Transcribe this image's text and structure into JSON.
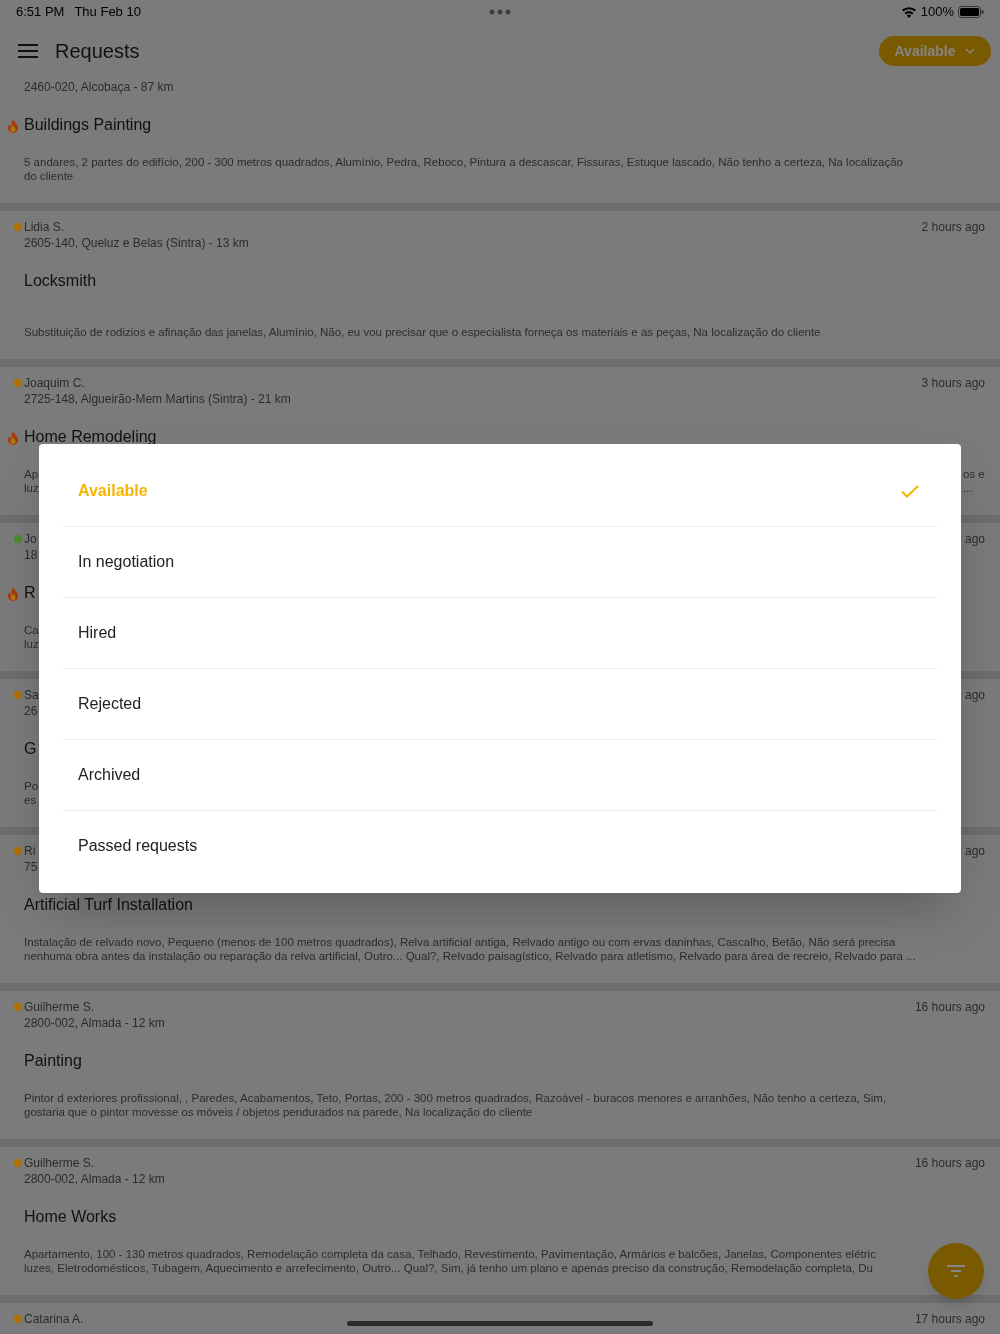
{
  "status_bar": {
    "time": "6:51 PM",
    "date": "Thu Feb 10",
    "battery": "100%"
  },
  "header": {
    "title": "Requests",
    "status_button": "Available"
  },
  "requests": [
    {
      "address": "2460-020, Alcobaça - 87 km",
      "title": "Buildings Painting",
      "urgent": true,
      "description": [
        "5 andares, 2 partes do edifício, 200 - 300 metros quadrados, Alumínio, Pedra, Reboco, Pintura a descascar, Fissuras, Estuque lascado, Não tenho a certeza, Na localização",
        "do cliente"
      ]
    },
    {
      "name": "Lidia S.",
      "color": "#b06f00",
      "time": "2 hours ago",
      "address": "2605-140, Queluz e Belas (Sintra) - 13 km",
      "title": "Locksmith",
      "urgent": false,
      "description": [
        "Substituição de rodizios e afinação das janelas, Alumínio, Não, eu vou precisar que o especialista forneça os materiais e as peças, Na localização do cliente"
      ]
    },
    {
      "name": "Joaquim C.",
      "color": "#b06f00",
      "time": "3 hours ago",
      "address": "2725-148, Algueirão-Mem Martins (Sintra) - 21 km",
      "title": "Home Remodeling",
      "urgent": true,
      "description": [
        "Ap",
        "luz"
      ],
      "description_end": [
        "os e",
        "..."
      ]
    },
    {
      "name": "Jo",
      "color": "#4d8a2b",
      "time": "ago",
      "address": "18",
      "title": "R",
      "urgent": true,
      "description": [
        "Ca",
        "luz"
      ]
    },
    {
      "name": "Sa",
      "color": "#b06f00",
      "time": "ago",
      "address": "26",
      "title": "G",
      "urgent": false,
      "description": [
        "Po",
        "es"
      ]
    },
    {
      "name": "Ri",
      "color": "#b06f00",
      "time": "ago",
      "address": "75",
      "title": "Artificial Turf Installation",
      "urgent": false,
      "description": [
        "Instalação de relvado novo, Pequeno (menos de 100 metros quadrados), Relva artificial antiga, Relvado antigo ou com ervas daninhas, Cascalho, Betão, Não será precisa",
        "nenhuma obra antes da instalação ou reparação da relva artificial, Outro... Qual?, Relvado paisagístico, Relvado para atletismo, Relvado para área de recreio, Relvado para ..."
      ]
    },
    {
      "name": "Guilherme S.",
      "color": "#b06f00",
      "time": "16 hours ago",
      "address": "2800-002, Almada - 12 km",
      "title": "Painting",
      "urgent": false,
      "description": [
        "Pintor d exteriores profissional, , Paredes, Acabamentos, Teto, Portas, 200 - 300 metros quadrados, Razoável - buracos menores e arranhões, Não tenho a certeza, Sim,",
        "gostaria que o pintor movesse os móveis / objetos pendurados na parede, Na localização do cliente"
      ]
    },
    {
      "name": "Guilherme S.",
      "color": "#b06f00",
      "time": "16 hours ago",
      "address": "2800-002, Almada - 12 km",
      "title": "Home Works",
      "urgent": false,
      "description": [
        "Apartamento, 100 - 130 metros quadrados, Remodelação completa da casa, Telhado, Revestimento, Pavimentação, Armários e balcões, Janelas, Componentes elétric",
        "luzes, Eletrodomésticos, Tubagem, Aquecimento e arrefecimento, Outro... Qual?, Sim, já tenho um plano e apenas preciso da construção, Remodelação completa, Du"
      ]
    },
    {
      "name": "Catarina A.",
      "color": "#b06f00",
      "time": "17 hours ago",
      "urgent": false
    }
  ],
  "status_menu": [
    {
      "label": "Available",
      "selected": true
    },
    {
      "label": "In negotiation",
      "selected": false
    },
    {
      "label": "Hired",
      "selected": false
    },
    {
      "label": "Rejected",
      "selected": false
    },
    {
      "label": "Archived",
      "selected": false
    },
    {
      "label": "Passed requests",
      "selected": false
    }
  ]
}
